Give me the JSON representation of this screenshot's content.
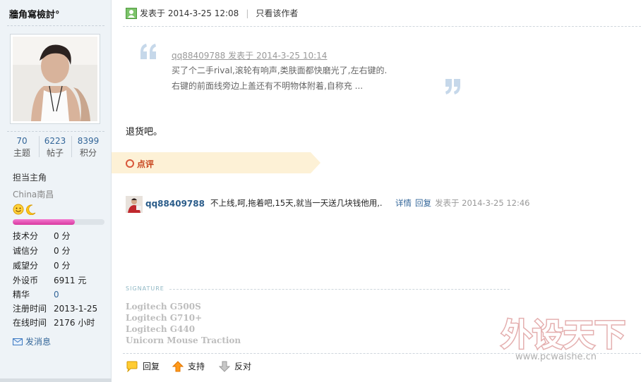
{
  "sidebar": {
    "username": "牆角寫檢討°",
    "stats": [
      {
        "value": "70",
        "label": "主题"
      },
      {
        "value": "6223",
        "label": "帖子"
      },
      {
        "value": "8399",
        "label": "积分"
      }
    ],
    "rank": "担当主角",
    "location": "China南昌",
    "progress": 0.68,
    "info": [
      {
        "label": "技术分",
        "value": "0 分"
      },
      {
        "label": "诚信分",
        "value": "0 分"
      },
      {
        "label": "威望分",
        "value": "0 分"
      },
      {
        "label": "外设币",
        "value": "6911 元"
      },
      {
        "label": "精华",
        "value": "0"
      },
      {
        "label": "注册时间",
        "value": "2013-1-25"
      },
      {
        "label": "在线时间",
        "value": "2176 小时"
      }
    ],
    "send_message": "发消息"
  },
  "header": {
    "posted_at": "发表于 2014-3-25 12:08",
    "only_author": "只看该作者"
  },
  "quote": {
    "meta": "qq88409788 发表于 2014-3-25 10:14",
    "line1": "买了个二手rival,滚轮有响声,类肤面都快磨光了,左右键的.",
    "line2": "右键的前面线旁边上盖还有不明物体附着,自称充 ..."
  },
  "reply": "退货吧。",
  "comment_section": {
    "title": "点评",
    "user": "qq88409788",
    "text": "不上线,呵,拖着吧,15天,就当一天送几块钱他用,.",
    "detail": "详情",
    "reply": "回复",
    "time": "发表于 2014-3-25 12:46"
  },
  "signature": {
    "label": "SIGNATURE",
    "items": [
      "Logitech G500S",
      "Logitech G710+",
      "Logitech G440",
      "Unicorn Mouse Traction"
    ]
  },
  "watermark": {
    "logo_text": "外设天下",
    "url": "www.pcwaishe.cn"
  },
  "actions": {
    "reply": "回复",
    "support": "支持",
    "oppose": "反对"
  },
  "colors": {
    "sidebar_bg": "#eef3f7",
    "link": "#336699",
    "banner": "#fdf1d6",
    "progress": "#d8379f"
  }
}
